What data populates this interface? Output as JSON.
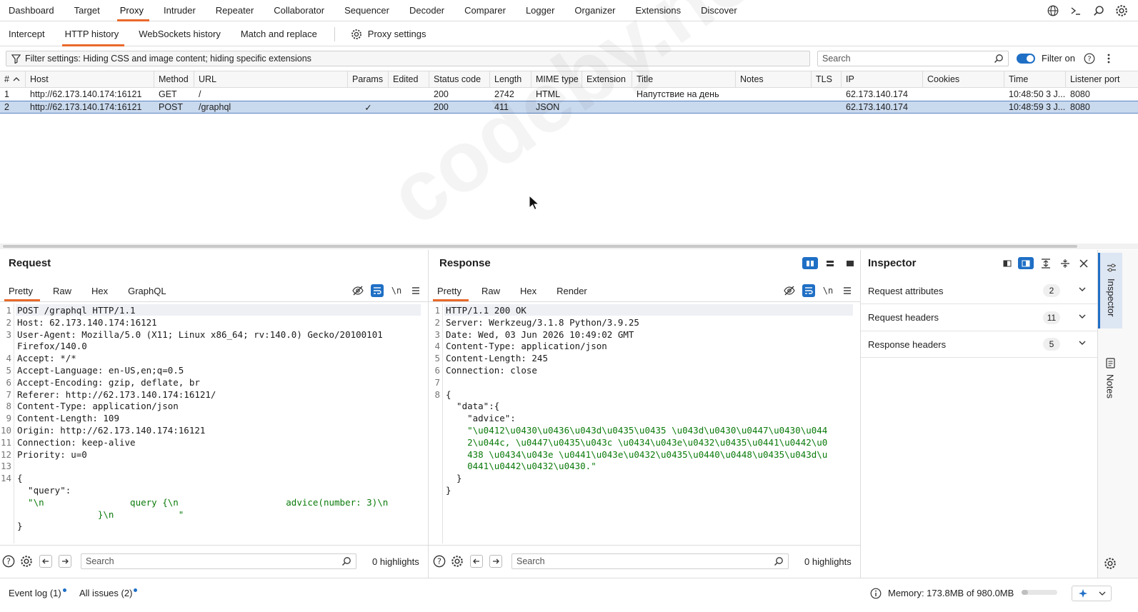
{
  "topnav": {
    "items": [
      "Dashboard",
      "Target",
      "Proxy",
      "Intruder",
      "Repeater",
      "Collaborator",
      "Sequencer",
      "Decoder",
      "Comparer",
      "Logger",
      "Organizer",
      "Extensions",
      "Discover"
    ],
    "active": "Proxy",
    "icons": [
      "globe-icon",
      "terminal-icon",
      "search-icon",
      "gear-icon"
    ]
  },
  "subnav": {
    "items": [
      "Intercept",
      "HTTP history",
      "WebSockets history",
      "Match and replace"
    ],
    "active": "HTTP history",
    "proxy_settings": "Proxy settings"
  },
  "filter": {
    "text": "Filter settings: Hiding CSS and image content; hiding specific extensions",
    "search_placeholder": "Search",
    "filter_on_label": "Filter on",
    "filter_on": true
  },
  "history_table": {
    "columns": [
      "#",
      "Host",
      "Method",
      "URL",
      "Params",
      "Edited",
      "Status code",
      "Length",
      "MIME type",
      "Extension",
      "Title",
      "Notes",
      "TLS",
      "IP",
      "Cookies",
      "Time",
      "Listener port"
    ],
    "rows": [
      {
        "num": "1",
        "host": "http://62.173.140.174:16121",
        "method": "GET",
        "url": "/",
        "params": "",
        "edited": "",
        "status": "200",
        "length": "2742",
        "mime": "HTML",
        "ext": "",
        "title": "Напутствие на день",
        "notes": "",
        "tls": "",
        "ip": "62.173.140.174",
        "cookies": "",
        "time": "10:48:50 3 J...",
        "port": "8080",
        "selected": false
      },
      {
        "num": "2",
        "host": "http://62.173.140.174:16121",
        "method": "POST",
        "url": "/graphql",
        "params": "✓",
        "edited": "",
        "status": "200",
        "length": "411",
        "mime": "JSON",
        "ext": "",
        "title": "",
        "notes": "",
        "tls": "",
        "ip": "62.173.140.174",
        "cookies": "",
        "time": "10:48:59 3 J...",
        "port": "8080",
        "selected": true
      }
    ]
  },
  "request": {
    "title": "Request",
    "tabs": [
      "Pretty",
      "Raw",
      "Hex",
      "GraphQL"
    ],
    "active_tab": "Pretty",
    "lines": [
      {
        "n": "1",
        "text": "POST /graphql HTTP/1.1"
      },
      {
        "n": "2",
        "text": "Host: 62.173.140.174:16121"
      },
      {
        "n": "3",
        "text": "User-Agent: Mozilla/5.0 (X11; Linux x86_64; rv:140.0) Gecko/20100101"
      },
      {
        "n": "",
        "text": "Firefox/140.0"
      },
      {
        "n": "4",
        "text": "Accept: */*"
      },
      {
        "n": "5",
        "text": "Accept-Language: en-US,en;q=0.5"
      },
      {
        "n": "6",
        "text": "Accept-Encoding: gzip, deflate, br"
      },
      {
        "n": "7",
        "text": "Referer: http://62.173.140.174:16121/"
      },
      {
        "n": "8",
        "text": "Content-Type: application/json"
      },
      {
        "n": "9",
        "text": "Content-Length: 109"
      },
      {
        "n": "10",
        "text": "Origin: http://62.173.140.174:16121"
      },
      {
        "n": "11",
        "text": "Connection: keep-alive"
      },
      {
        "n": "12",
        "text": "Priority: u=0"
      },
      {
        "n": "13",
        "text": ""
      },
      {
        "n": "14",
        "text": "{"
      },
      {
        "n": "",
        "text": "  \"query\":"
      },
      {
        "n": "",
        "text": "  \"\\n                query {\\n                    advice(number: 3)\\n",
        "str": true
      },
      {
        "n": "",
        "text": "               }\\n            \"",
        "str": true
      },
      {
        "n": "",
        "text": "}"
      }
    ],
    "search_placeholder": "Search",
    "highlights": "0 highlights"
  },
  "response": {
    "title": "Response",
    "tabs": [
      "Pretty",
      "Raw",
      "Hex",
      "Render"
    ],
    "active_tab": "Pretty",
    "lines": [
      {
        "n": "1",
        "text": "HTTP/1.1 200 OK"
      },
      {
        "n": "2",
        "text": "Server: Werkzeug/3.1.8 Python/3.9.25"
      },
      {
        "n": "3",
        "text": "Date: Wed, 03 Jun 2026 10:49:02 GMT"
      },
      {
        "n": "4",
        "text": "Content-Type: application/json"
      },
      {
        "n": "5",
        "text": "Content-Length: 245"
      },
      {
        "n": "6",
        "text": "Connection: close"
      },
      {
        "n": "7",
        "text": ""
      },
      {
        "n": "8",
        "text": "{"
      },
      {
        "n": "",
        "text": "  \"data\":{"
      },
      {
        "n": "",
        "text": "    \"advice\":"
      },
      {
        "n": "",
        "text": "    \"\\u0412\\u0430\\u0436\\u043d\\u0435\\u0435 \\u043d\\u0430\\u0447\\u0430\\u044",
        "str": true
      },
      {
        "n": "",
        "text": "    2\\u044c, \\u0447\\u0435\\u043c \\u0434\\u043e\\u0432\\u0435\\u0441\\u0442\\u0",
        "str": true
      },
      {
        "n": "",
        "text": "    438 \\u0434\\u043e \\u0441\\u043e\\u0432\\u0435\\u0440\\u0448\\u0435\\u043d\\u",
        "str": true
      },
      {
        "n": "",
        "text": "    0441\\u0442\\u0432\\u0430.\"",
        "str": true
      },
      {
        "n": "",
        "text": "  }"
      },
      {
        "n": "",
        "text": "}"
      }
    ],
    "search_placeholder": "Search",
    "highlights": "0 highlights"
  },
  "inspector": {
    "title": "Inspector",
    "rows": [
      {
        "label": "Request attributes",
        "count": "2"
      },
      {
        "label": "Request headers",
        "count": "11"
      },
      {
        "label": "Response headers",
        "count": "5"
      }
    ]
  },
  "sidebar": {
    "tabs": [
      "Inspector",
      "Notes"
    ]
  },
  "statusbar": {
    "event_log": "Event log (1)",
    "all_issues": "All issues (2)",
    "memory": "Memory: 173.8MB of 980.0MB",
    "memory_fraction": 0.177
  },
  "watermark": "codeby.net"
}
